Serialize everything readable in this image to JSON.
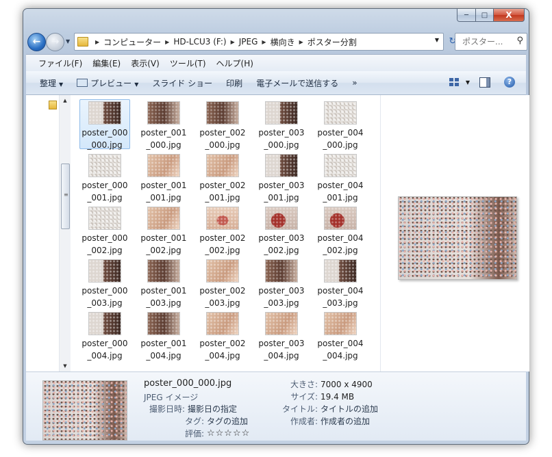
{
  "window": {
    "caption": {
      "minimize": "─",
      "maximize": "□",
      "close": "X"
    }
  },
  "nav": {
    "back_icon": "back-arrow-icon",
    "forward_icon": "forward-arrow-icon",
    "breadcrumb": [
      "コンピューター",
      "HD-LCU3 (F:)",
      "JPEG",
      "横向き",
      "ポスター分割"
    ],
    "search_placeholder": "ポスター..."
  },
  "menu": [
    "ファイル(F)",
    "編集(E)",
    "表示(V)",
    "ツール(T)",
    "ヘルプ(H)"
  ],
  "toolbar": {
    "organize": "整理",
    "preview": "プレビュー",
    "slideshow": "スライド ショー",
    "print": "印刷",
    "email": "電子メールで送信する",
    "more": "»"
  },
  "files": [
    {
      "name": "poster_000_000.jpg",
      "style": "t-half"
    },
    {
      "name": "poster_001_000.jpg",
      "style": "t-dark"
    },
    {
      "name": "poster_002_000.jpg",
      "style": "t-dark"
    },
    {
      "name": "poster_003_000.jpg",
      "style": "t-half"
    },
    {
      "name": "poster_004_000.jpg",
      "style": "plain"
    },
    {
      "name": "poster_000_001.jpg",
      "style": "plain"
    },
    {
      "name": "poster_001_001.jpg",
      "style": "t-skin"
    },
    {
      "name": "poster_002_001.jpg",
      "style": "t-skin"
    },
    {
      "name": "poster_003_001.jpg",
      "style": "t-half"
    },
    {
      "name": "poster_004_001.jpg",
      "style": "plain"
    },
    {
      "name": "poster_000_002.jpg",
      "style": "plain"
    },
    {
      "name": "poster_001_002.jpg",
      "style": "t-skin"
    },
    {
      "name": "poster_002_002.jpg",
      "style": "t-lips"
    },
    {
      "name": "poster_003_002.jpg",
      "style": "t-red"
    },
    {
      "name": "poster_004_002.jpg",
      "style": "t-red"
    },
    {
      "name": "poster_000_003.jpg",
      "style": "t-half"
    },
    {
      "name": "poster_001_003.jpg",
      "style": "t-dark"
    },
    {
      "name": "poster_002_003.jpg",
      "style": "t-skin"
    },
    {
      "name": "poster_003_003.jpg",
      "style": "t-dark"
    },
    {
      "name": "poster_004_003.jpg",
      "style": "t-half"
    },
    {
      "name": "poster_000_004.jpg",
      "style": "t-half"
    },
    {
      "name": "poster_001_004.jpg",
      "style": "t-dark"
    },
    {
      "name": "poster_002_004.jpg",
      "style": "t-skin"
    },
    {
      "name": "poster_003_004.jpg",
      "style": "t-skin"
    },
    {
      "name": "poster_004_004.jpg",
      "style": "t-skin"
    }
  ],
  "selected_index": 0,
  "details": {
    "filename": "poster_000_000.jpg",
    "type": "JPEG イメージ",
    "date_label": "撮影日時:",
    "date_value": "撮影日の指定",
    "tags_label": "タグ:",
    "tags_value": "タグの追加",
    "rating_label": "評価:",
    "rating_stars": "☆☆☆☆☆",
    "dims_label": "大きさ:",
    "dims_value": "7000 x 4900",
    "size_label": "サイズ:",
    "size_value": "19.4 MB",
    "title_label": "タイトル:",
    "title_value": "タイトルの追加",
    "author_label": "作成者:",
    "author_value": "作成者の追加"
  }
}
